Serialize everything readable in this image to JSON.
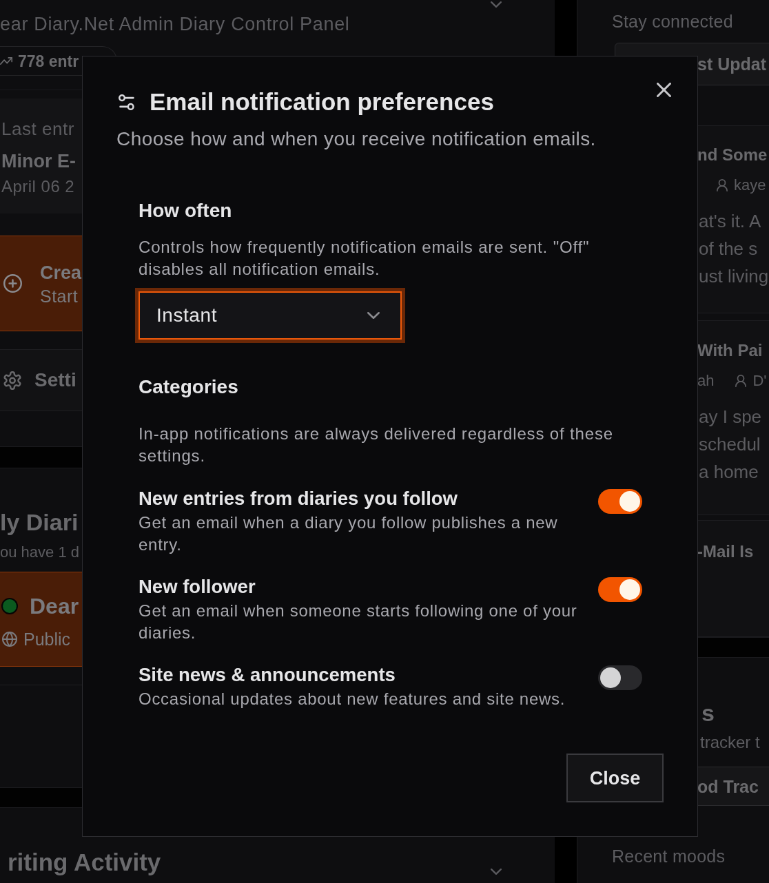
{
  "background": {
    "left": {
      "subtitle": "ear Diary.Net Admin Diary Control Panel",
      "stat": "778 entr",
      "last_entry": {
        "label": "Last entr",
        "title": "Minor E-",
        "date": "April 06 2"
      },
      "create_card": {
        "title": "Crea",
        "subtitle": "Start"
      },
      "settings_link": "Setti",
      "diaries": {
        "heading": "ly Diari",
        "count": "ou have 1 d",
        "diary": {
          "name": "Dear",
          "visibility": "Public"
        }
      },
      "activity_heading": "riting Activity"
    },
    "right": {
      "subtitle": "Stay connected",
      "updates_button": "st Updat",
      "posts": [
        {
          "title": "nd Some",
          "meta": [
            {
              "kind": "author",
              "text": "kaye"
            }
          ],
          "excerpt_lines": [
            "at's it. A",
            "of the s",
            "ust living"
          ]
        },
        {
          "title": "With Pai",
          "meta": [
            {
              "kind": "text",
              "text": "ah"
            },
            {
              "kind": "author",
              "text": "D'"
            }
          ],
          "excerpt_lines": [
            "ay I spe",
            "schedul",
            "a home"
          ]
        },
        {
          "title": "-Mail Is"
        }
      ],
      "mood": {
        "heading": "s",
        "description": "tracker t",
        "button": "od Trac",
        "recent_label": "Recent moods"
      }
    }
  },
  "dialog": {
    "title": "Email notification preferences",
    "description": "Choose how and when you receive notification emails.",
    "frequency": {
      "heading": "How often",
      "help": "Controls how frequently notification emails are sent. \"Off\" disables all notification emails.",
      "value": "Instant",
      "focused": true
    },
    "categories": {
      "heading": "Categories",
      "note": "In-app notifications are always delivered regardless of these settings.",
      "items": [
        {
          "title": "New entries from diaries you follow",
          "description": "Get an email when a diary you follow publishes a new entry.",
          "on": true
        },
        {
          "title": "New follower",
          "description": "Get an email when someone starts following one of your diaries.",
          "on": true
        },
        {
          "title": "Site news & announcements",
          "description": "Occasional updates about new features and site news.",
          "on": false
        }
      ]
    },
    "close_button": "Close"
  }
}
